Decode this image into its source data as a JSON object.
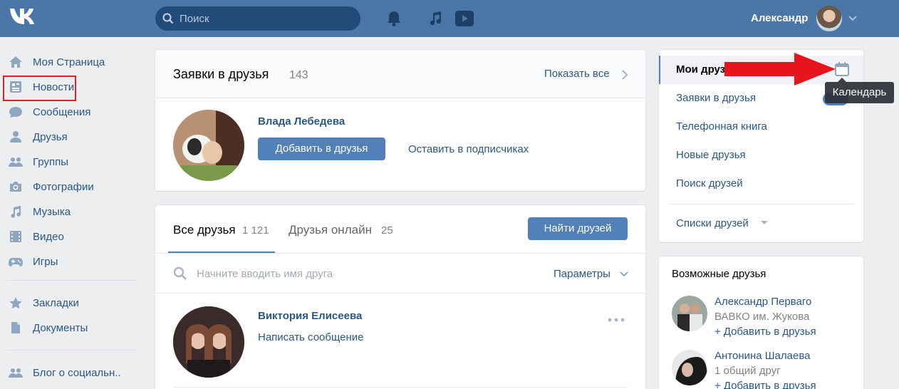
{
  "header": {
    "logo": "VK",
    "search_placeholder": "Поиск",
    "user_name": "Александр"
  },
  "sidebar": {
    "items": [
      {
        "label": "Моя Страница",
        "icon": "home-icon"
      },
      {
        "label": "Новости",
        "icon": "news-icon"
      },
      {
        "label": "Сообщения",
        "icon": "messages-icon"
      },
      {
        "label": "Друзья",
        "icon": "friends-icon"
      },
      {
        "label": "Группы",
        "icon": "groups-icon"
      },
      {
        "label": "Фотографии",
        "icon": "camera-icon"
      },
      {
        "label": "Музыка",
        "icon": "music-icon"
      },
      {
        "label": "Видео",
        "icon": "video-icon"
      },
      {
        "label": "Игры",
        "icon": "gamepad-icon"
      },
      {
        "label": "Закладки",
        "icon": "star-icon"
      },
      {
        "label": "Документы",
        "icon": "document-icon"
      },
      {
        "label": "Блог о социальн..",
        "icon": "community-icon"
      }
    ],
    "highlighted_item": "Друзья"
  },
  "requests": {
    "title": "Заявки в друзья",
    "count": "143",
    "show_all": "Показать все",
    "person_name": "Влада Лебедева",
    "add_button": "Добавить в друзья",
    "leave_link": "Оставить в подписчиках"
  },
  "friends": {
    "tab_all": "Все друзья",
    "tab_all_count": "1 121",
    "tab_online": "Друзья онлайн",
    "tab_online_count": "25",
    "find_button": "Найти друзей",
    "search_placeholder": "Начните вводить имя друга",
    "params": "Параметры",
    "friend_name": "Виктория Елисеева",
    "write_message": "Написать сообщение"
  },
  "right_nav": {
    "selected": "Мои друзья",
    "items": [
      "Заявки в друзья",
      "Телефонная книга",
      "Новые друзья",
      "Поиск друзей"
    ],
    "badge": "143",
    "lists": "Списки друзей",
    "tooltip": "Календарь"
  },
  "possible": {
    "title": "Возможные друзья",
    "people": [
      {
        "name": "Александр Перваго",
        "sub": "ВАВКО им. Жукова",
        "add": "Добавить в друзья"
      },
      {
        "name": "Антонина Шалаева",
        "sub": "1 общий друг",
        "add": "Добавить в друзья"
      }
    ]
  },
  "colors": {
    "header": "#4a76a8",
    "accent": "#5181b8",
    "link": "#2a5885",
    "annotation": "#e0202c"
  }
}
